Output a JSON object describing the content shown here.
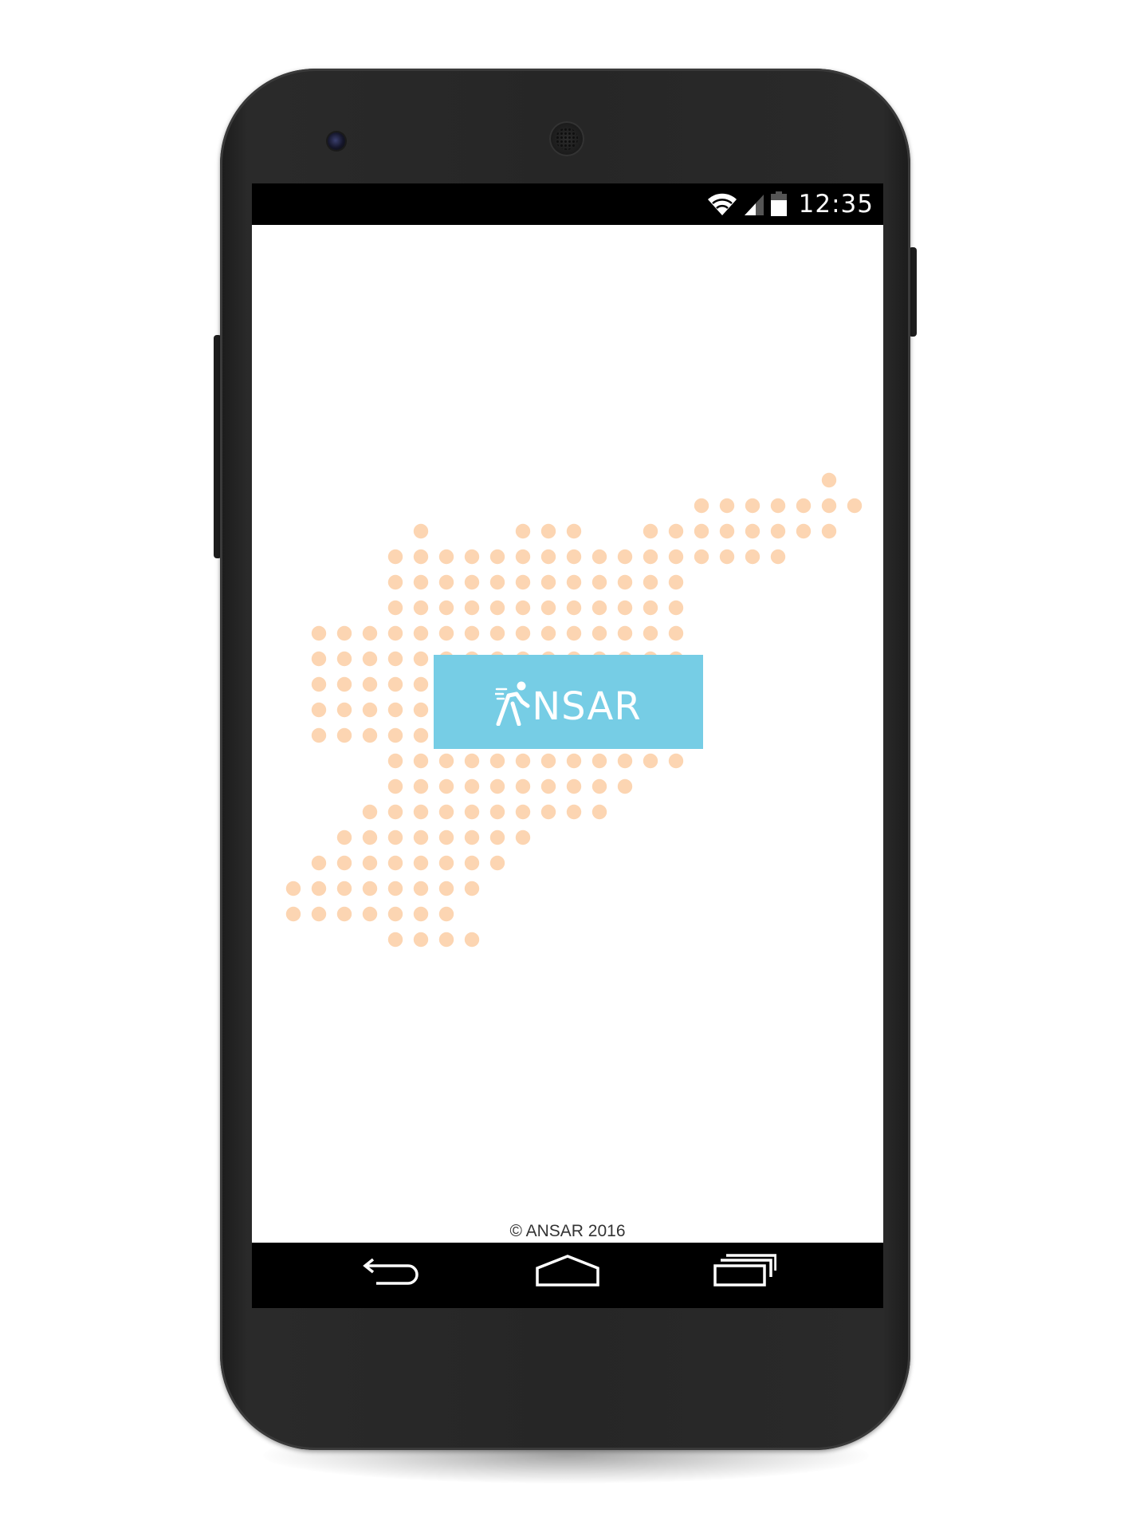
{
  "status_bar": {
    "time": "12:35",
    "icons": [
      "wifi-icon",
      "signal-icon",
      "battery-icon"
    ]
  },
  "splash": {
    "logo_text": "NSAR",
    "logo_alt": "ANSAR",
    "copyright": "© ANSAR 2016"
  },
  "nav_bar": {
    "buttons": [
      "back-icon",
      "home-icon",
      "recents-icon"
    ]
  },
  "colors": {
    "dots": "#fcd5b2",
    "logo_background": "#76cde5",
    "status_bar": "#000000",
    "nav_bar": "#000000",
    "screen": "#ffffff"
  }
}
